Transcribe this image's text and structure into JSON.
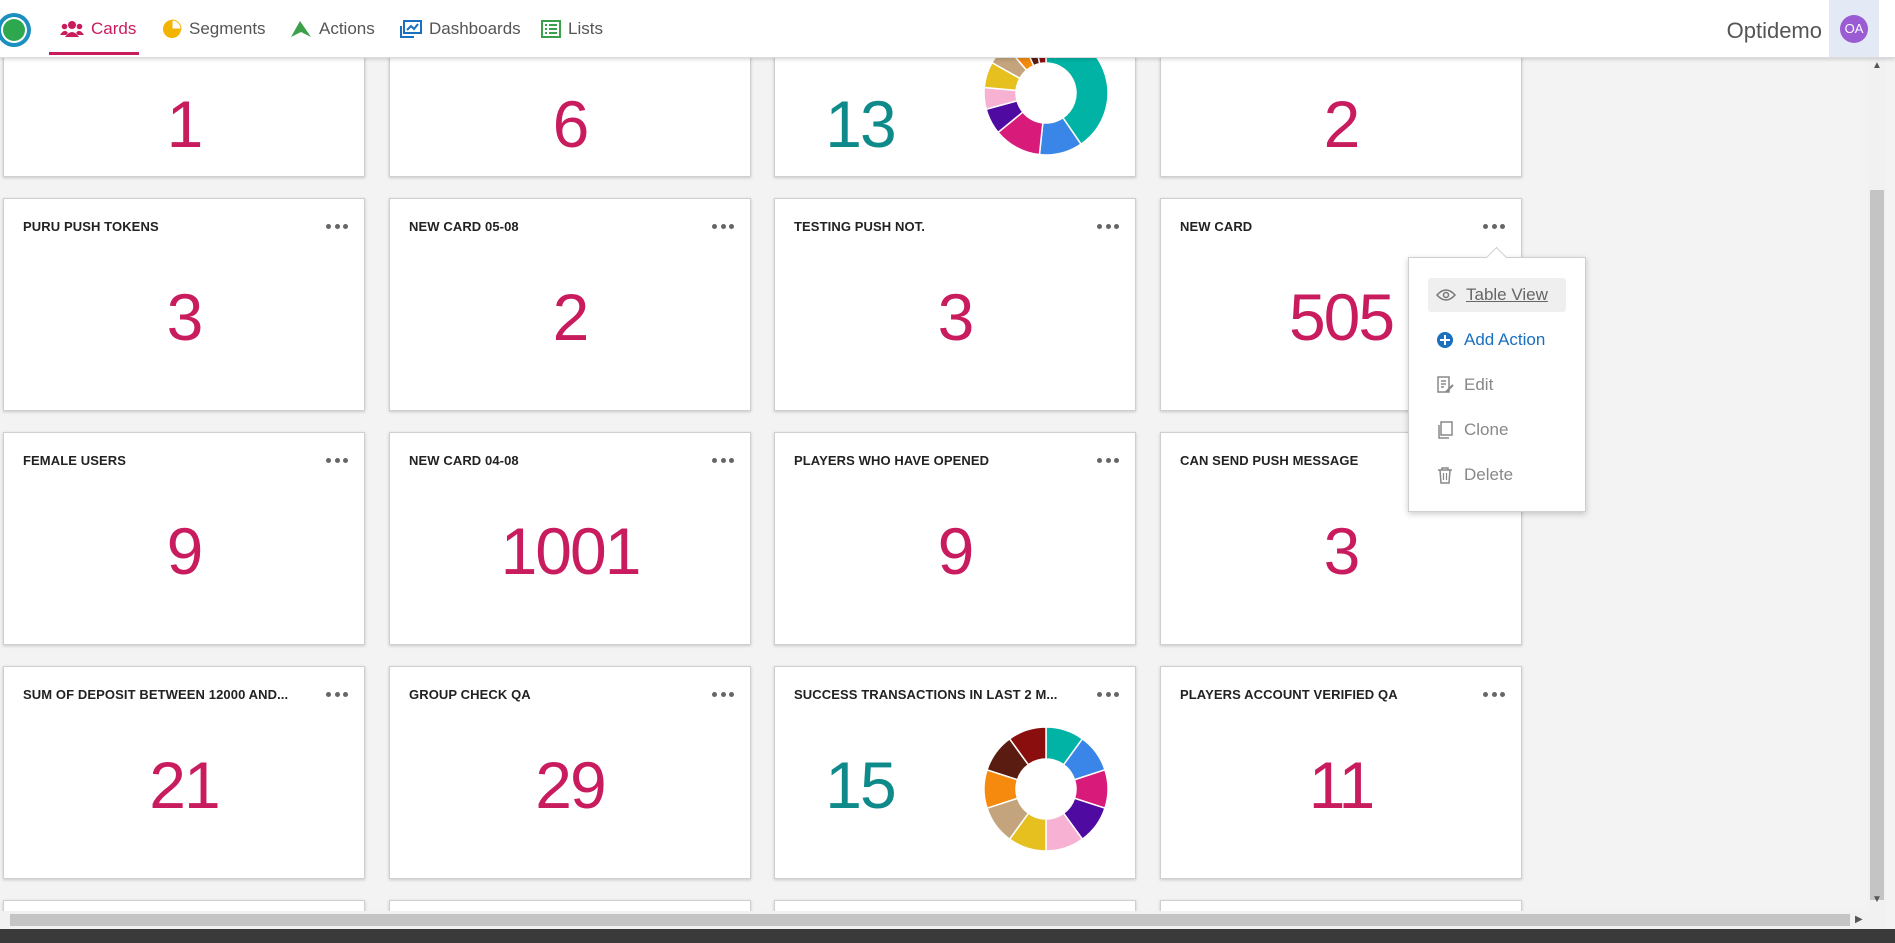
{
  "app": {
    "brand": "Optidemo",
    "avatar_initials": "OA"
  },
  "nav": {
    "tabs": [
      {
        "label": "Cards",
        "icon": "users-icon",
        "active": true,
        "color": "#c81c5e"
      },
      {
        "label": "Segments",
        "icon": "pie-chart-icon",
        "active": false,
        "color": "#f2b400"
      },
      {
        "label": "Actions",
        "icon": "paper-plane-icon",
        "active": false,
        "color": "#3aa04a"
      },
      {
        "label": "Dashboards",
        "icon": "dashboard-icon",
        "active": false,
        "color": "#1a6fbf"
      },
      {
        "label": "Lists",
        "icon": "list-icon",
        "active": false,
        "color": "#3aa04a"
      }
    ]
  },
  "cards": {
    "row0": [
      {
        "value": "1"
      },
      {
        "value": "6"
      },
      {
        "value": "13",
        "chart": true
      },
      {
        "value": "2"
      }
    ],
    "row1": [
      {
        "title": "PURU PUSH TOKENS",
        "value": "3"
      },
      {
        "title": "NEW CARD 05-08",
        "value": "2"
      },
      {
        "title": "TESTING PUSH NOT.",
        "value": "3"
      },
      {
        "title": "NEW CARD",
        "value": "505"
      }
    ],
    "row2": [
      {
        "title": "FEMALE USERS",
        "value": "9"
      },
      {
        "title": "NEW CARD 04-08",
        "value": "1001"
      },
      {
        "title": "PLAYERS WHO HAVE OPENED",
        "value": "9"
      },
      {
        "title": "CAN SEND PUSH MESSAGE",
        "value": "3"
      }
    ],
    "row3": [
      {
        "title": "SUM OF DEPOSIT BETWEEN 12000 AND...",
        "value": "21"
      },
      {
        "title": "GROUP CHECK QA",
        "value": "29"
      },
      {
        "title": "SUCCESS TRANSACTIONS IN LAST 2 M...",
        "value": "15",
        "chart": true
      },
      {
        "title": "PLAYERS ACCOUNT VERIFIED QA",
        "value": "11"
      }
    ]
  },
  "donut_colors": [
    "#00b3a4",
    "#3a86e8",
    "#d81b7a",
    "#4f0aa1",
    "#f7b2d3",
    "#e6c01f",
    "#c4a47c",
    "#f58a0f",
    "#5a1c10",
    "#8b0e0e"
  ],
  "donut_top": {
    "values": [
      36,
      10,
      11,
      6,
      5,
      6,
      5,
      4,
      3,
      3
    ]
  },
  "donut_bottom": {
    "values": [
      10,
      10,
      10,
      10,
      10,
      10,
      10,
      10,
      10,
      10
    ]
  },
  "menu": {
    "items": [
      {
        "label": "Table View",
        "icon": "eye-icon"
      },
      {
        "label": "Add Action",
        "icon": "plus-circle-icon"
      },
      {
        "label": "Edit",
        "icon": "edit-icon"
      },
      {
        "label": "Clone",
        "icon": "clone-icon"
      },
      {
        "label": "Delete",
        "icon": "trash-icon"
      }
    ]
  }
}
